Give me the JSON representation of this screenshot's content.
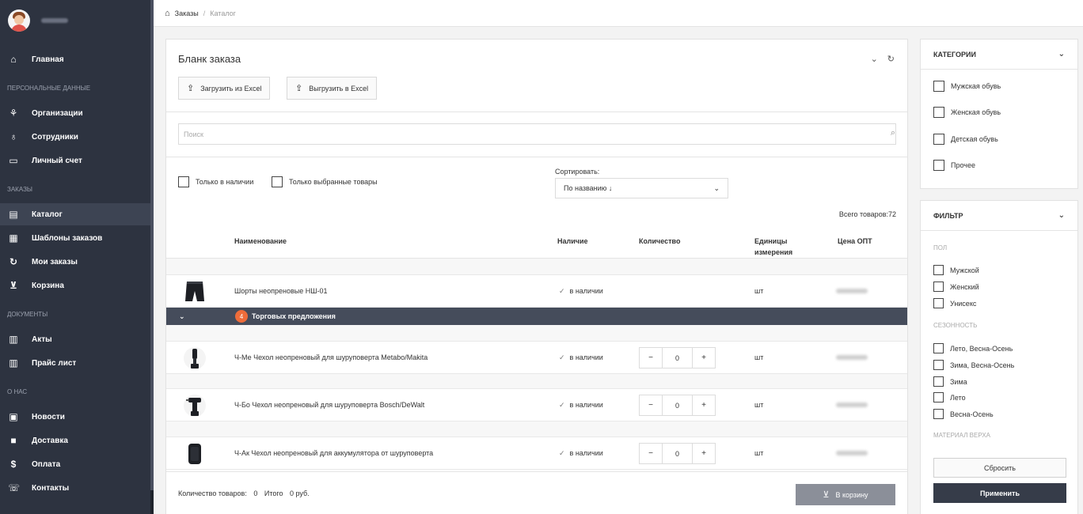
{
  "sidebar": {
    "nav": {
      "home": "Главная",
      "orgs": "Организации",
      "employees": "Сотрудники",
      "account": "Личный счет",
      "catalog": "Каталог",
      "templates": "Шаблоны заказов",
      "my_orders": "Мои заказы",
      "cart": "Корзина",
      "acts": "Акты",
      "price_list": "Прайс лист",
      "news": "Новости",
      "delivery": "Доставка",
      "payment": "Оплата",
      "contacts": "Контакты"
    },
    "sections": {
      "personal": "ПЕРСОНАЛЬНЫЕ ДАННЫЕ",
      "orders": "ЗАКАЗЫ",
      "documents": "ДОКУМЕНТЫ",
      "about": "О НАС"
    },
    "icons": {
      "home": "home-icon",
      "orgs": "sitemap-icon",
      "employees": "user-icon",
      "account": "credit-card-icon",
      "catalog": "clipboard-icon",
      "templates": "grid-icon",
      "my_orders": "refresh-icon",
      "cart": "cart-icon",
      "acts": "document-icon",
      "price_list": "document-icon",
      "news": "newspaper-icon",
      "delivery": "truck-icon",
      "payment": "dollar-icon",
      "contacts": "phone-icon"
    }
  },
  "breadcrumb": {
    "orders": "Заказы",
    "separator": "/",
    "catalog": "Каталог"
  },
  "main": {
    "title": "Бланк заказа",
    "upload_excel": "Загрузить из Excel",
    "download_excel": "Выгрузить в Excel",
    "search_placeholder": "Поиск",
    "only_in_stock": "Только в наличии",
    "only_selected": "Только выбранные товары",
    "sort_label": "Сортировать:",
    "sort_value": "По названию ↓",
    "total_products": "Всего товаров:72",
    "columns": {
      "name": "Наименование",
      "availability": "Наличие",
      "quantity": "Количество",
      "units_line1": "Единицы",
      "units_line2": "измерения",
      "price": "Цена ОПТ"
    },
    "product": {
      "name": "Шорты неопреновые НШ-01",
      "availability": "в наличии",
      "unit": "шт"
    },
    "offers": {
      "count": "4",
      "label": "Торговых предложения"
    },
    "variants": [
      {
        "name": "Ч-Ме Чехол неопреновый для шуруповерта Metabo/Makita",
        "availability": "в наличии",
        "qty": "0",
        "unit": "шт"
      },
      {
        "name": "Ч-Бо Чехол неопреновый для шуруповерта Bosch/DeWalt",
        "availability": "в наличии",
        "qty": "0",
        "unit": "шт"
      },
      {
        "name": "Ч-Ак Чехол неопреновый для аккумулятора от шуруповерта",
        "availability": "в наличии",
        "qty": "0",
        "unit": "шт"
      }
    ],
    "stepper_minus": "−",
    "stepper_plus": "+",
    "footer": {
      "qty_label": "Количество товаров:",
      "qty_value": "0",
      "total_label": "Итого",
      "total_value": "0 руб."
    },
    "cart_button": "В корзину"
  },
  "categories": {
    "title": "КАТЕГОРИИ",
    "items": [
      "Мужская обувь",
      "Женская обувь",
      "Детская обувь",
      "Прочее"
    ]
  },
  "filter": {
    "title": "ФИЛЬТР",
    "sections": {
      "gender": "ПОЛ",
      "season": "СЕЗОННОСТЬ",
      "material": "МАТЕРИАЛ ВЕРХА"
    },
    "gender": [
      "Мужской",
      "Женский",
      "Унисекс"
    ],
    "season": [
      "Лето, Весна-Осень",
      "Зима, Весна-Осень",
      "Зима",
      "Лето",
      "Весна-Осень"
    ],
    "reset": "Сбросить",
    "apply": "Применить"
  },
  "colors": {
    "sidebar_bg": "#2d3340",
    "offers_bar": "#454c5b",
    "badge": "#ee6c3a",
    "apply_button": "#363c49",
    "cart_button": "#8b8f99"
  }
}
